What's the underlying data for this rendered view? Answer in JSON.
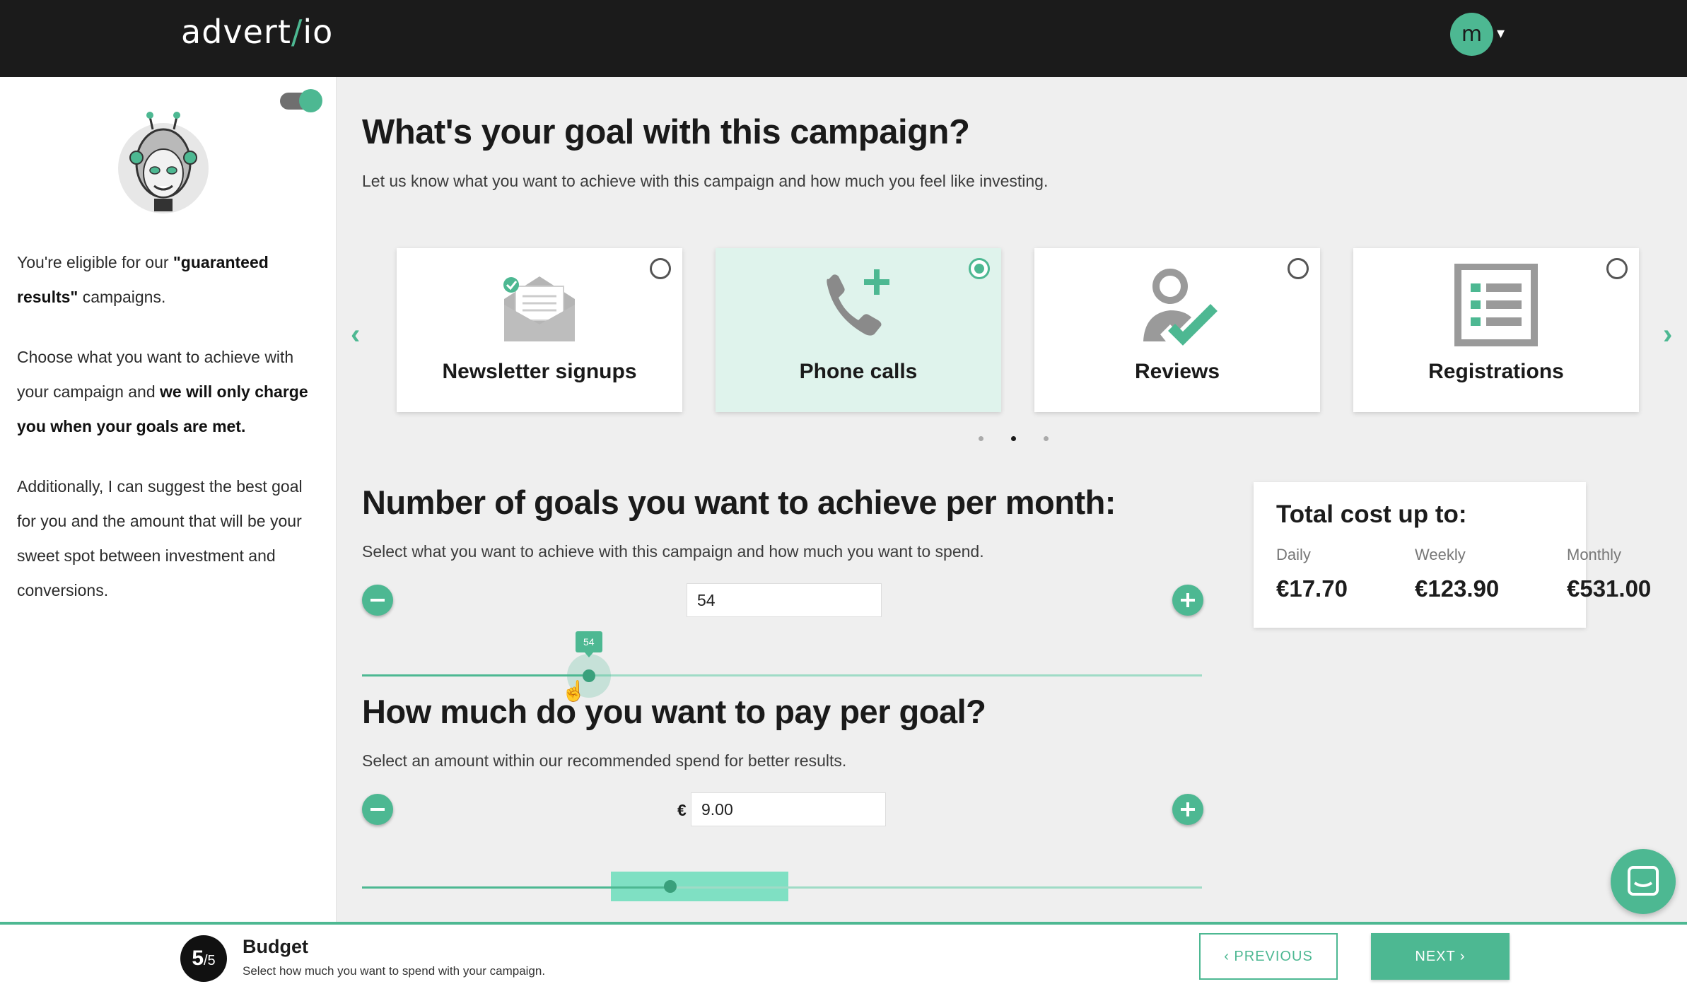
{
  "header": {
    "logo_left": "advert",
    "logo_slash": "/",
    "logo_right": "io",
    "user_initial": "m",
    "caret": "▾"
  },
  "sidebar": {
    "toggle_on": true,
    "p1_pre": "You're eligible for our ",
    "p1_bold": "\"guaranteed results\"",
    "p1_post": " campaigns.",
    "p2_pre": "Choose what you want to achieve with your campaign and ",
    "p2_bold": "we will only charge you when your goals are met.",
    "p3": "Additionally, I can suggest the best goal for you and the amount that will be your sweet spot between investment and conversions."
  },
  "goal_section": {
    "title": "What's your goal with this campaign?",
    "subtitle": "Let us know what you want to achieve with this campaign and how much you feel like investing.",
    "cards": [
      {
        "label": "Newsletter signups",
        "icon": "envelope-icon",
        "selected": false
      },
      {
        "label": "Phone calls",
        "icon": "phone-add-icon",
        "selected": true
      },
      {
        "label": "Reviews",
        "icon": "user-check-icon",
        "selected": false
      },
      {
        "label": "Registrations",
        "icon": "list-form-icon",
        "selected": false
      }
    ],
    "prev_arrow": "‹",
    "next_arrow": "›",
    "pages": 3,
    "active_page": 2
  },
  "goals_count": {
    "title": "Number of goals you want to achieve per month:",
    "subtitle": "Select what you want to achieve with this campaign and how much you want to spend.",
    "value": "54",
    "slider_label": "54",
    "slider_fraction": 0.27
  },
  "pay_per_goal": {
    "title": "How much do you want to pay per goal?",
    "subtitle": "Select an amount within our recommended spend for better results.",
    "currency": "€",
    "value": "9.00",
    "slider_fraction": 0.367,
    "recommended_from": 0.296,
    "recommended_to": 0.508
  },
  "total_cost": {
    "title": "Total cost up to:",
    "daily_label": "Daily",
    "daily_value": "€17.70",
    "weekly_label": "Weekly",
    "weekly_value": "€123.90",
    "monthly_label": "Monthly",
    "monthly_value": "€531.00"
  },
  "footer": {
    "step_current": "5",
    "step_total": "/5",
    "step_title": "Budget",
    "step_subtitle": "Select how much you want to spend with your campaign.",
    "prev_label": "PREVIOUS",
    "next_label": "NEXT"
  },
  "colors": {
    "accent": "#4db892",
    "dark": "#1b1b1b",
    "selected_card": "#dff3ec"
  }
}
